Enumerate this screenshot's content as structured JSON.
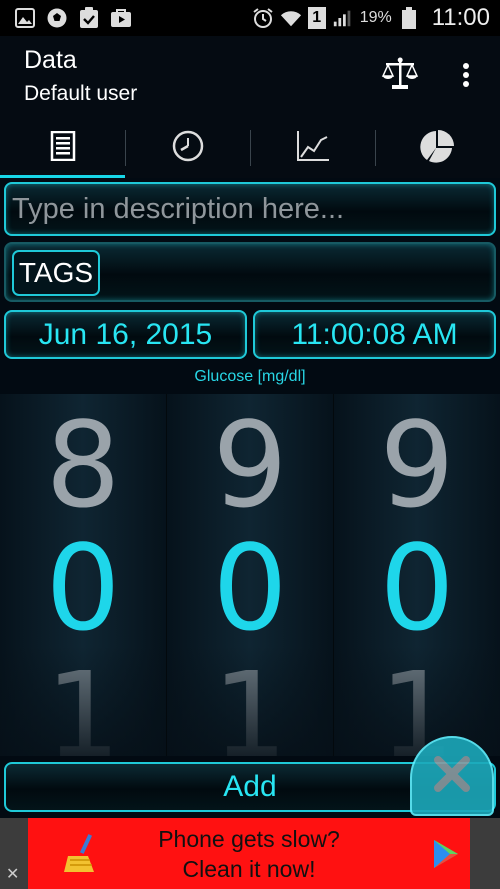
{
  "status_bar": {
    "battery_percent": "19%",
    "time": "11:00",
    "sim_slot": "1",
    "icons": [
      "gallery-icon",
      "soccer-icon",
      "clipboard-check-icon",
      "play-store-icon",
      "alarm-icon",
      "wifi-icon",
      "signal-icon",
      "battery-icon"
    ]
  },
  "action_bar": {
    "title": "Data",
    "subtitle": "Default user",
    "icons": [
      "scale-icon",
      "overflow-menu-icon"
    ]
  },
  "tabs": [
    {
      "icon": "list-icon",
      "active": true
    },
    {
      "icon": "clock-icon",
      "active": false
    },
    {
      "icon": "line-chart-icon",
      "active": false
    },
    {
      "icon": "pie-chart-icon",
      "active": false
    }
  ],
  "form": {
    "description_placeholder": "Type in description here...",
    "tags_label": "TAGS",
    "date": "Jun 16, 2015",
    "time": "11:00:08 AM",
    "measure_label": "Glucose  [mg/dl]"
  },
  "picker": {
    "columns": [
      {
        "prev": "8",
        "current": "0",
        "next": "1"
      },
      {
        "prev": "9",
        "current": "0",
        "next": "1"
      },
      {
        "prev": "9",
        "current": "0",
        "next": "1"
      }
    ]
  },
  "add_label": "Add",
  "ad": {
    "line1": "Phone gets slow?",
    "line2": "Clean it now!",
    "close_glyph": "✕"
  },
  "colors": {
    "accent": "#1fc9d8",
    "accent_text": "#28e5f2",
    "ad_background": "#ff1111"
  }
}
